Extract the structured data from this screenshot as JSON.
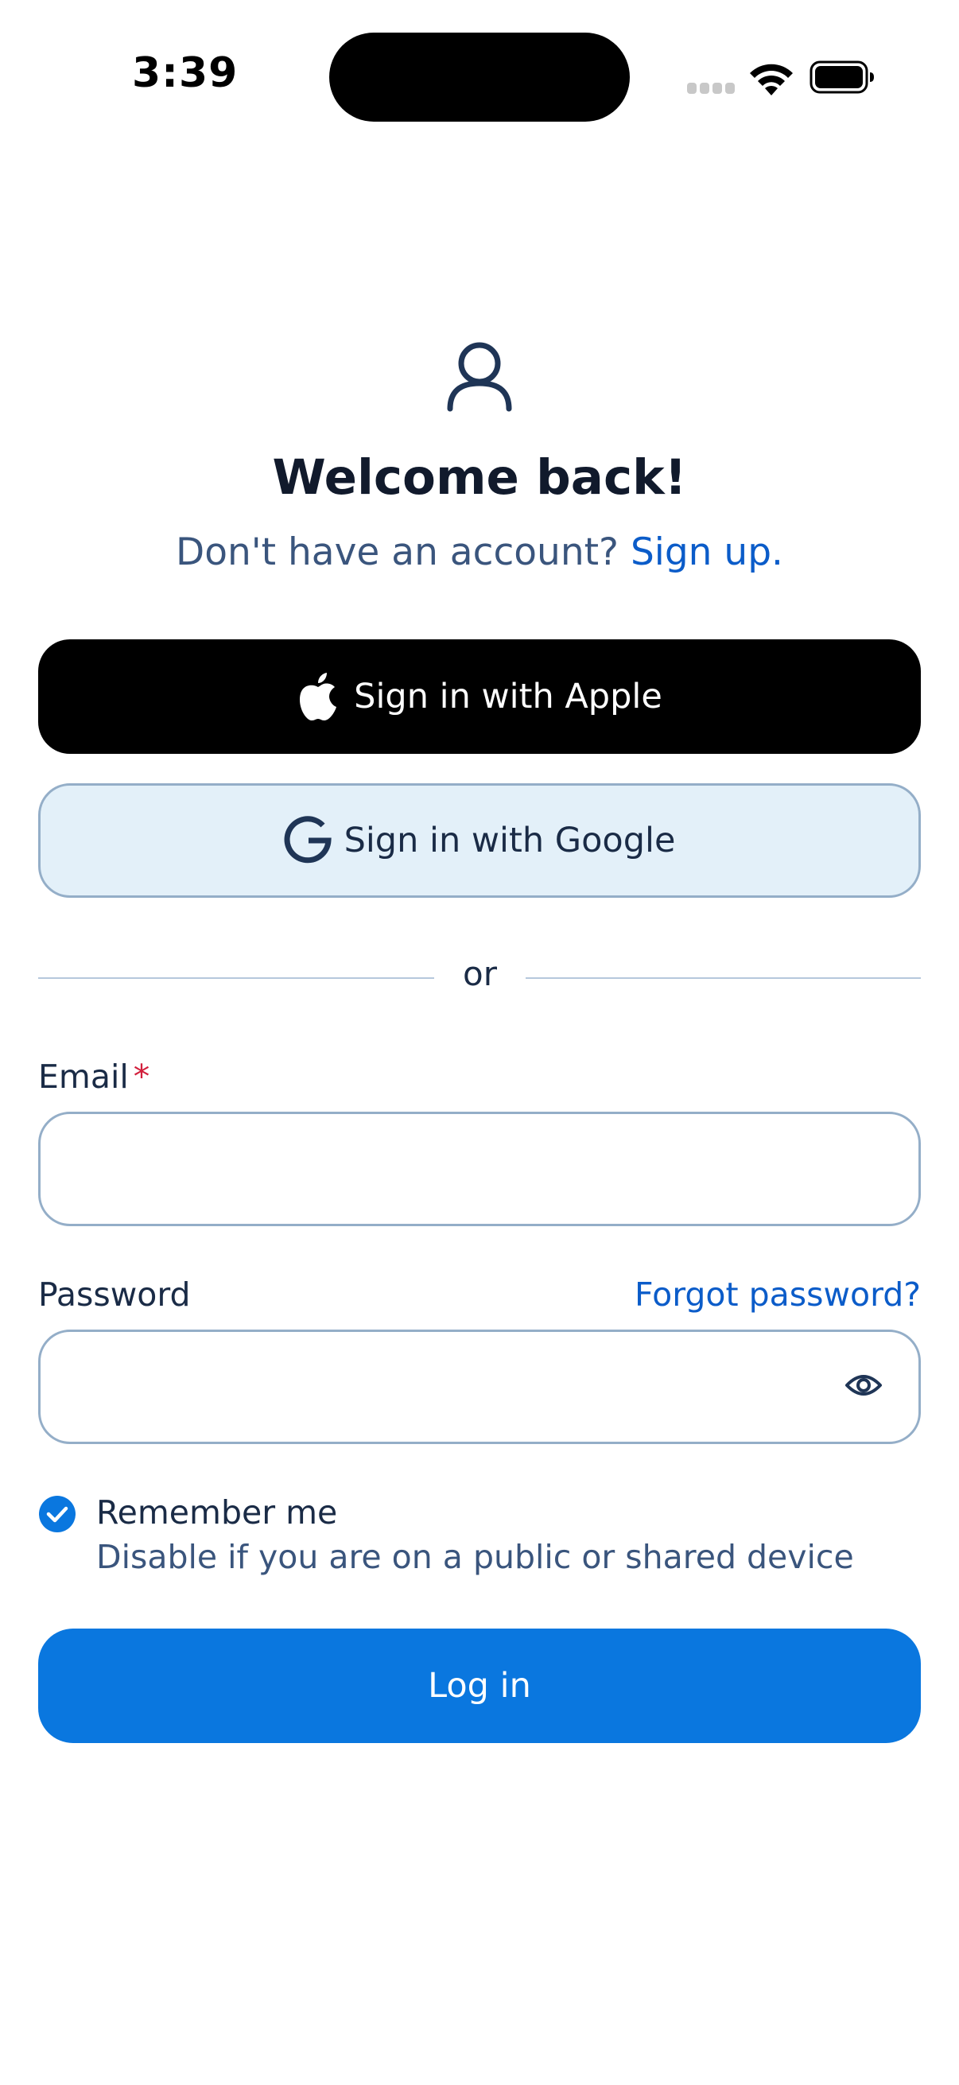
{
  "status_bar": {
    "time": "3:39"
  },
  "header": {
    "icon": "person-icon",
    "title": "Welcome back!",
    "subtitle_prefix": "Don't have an account? ",
    "signup_link": "Sign up."
  },
  "social": {
    "apple_label": "Sign in with Apple",
    "apple_icon": "apple-icon",
    "google_label": "Sign in with Google",
    "google_icon": "google-icon"
  },
  "divider": {
    "text": "or"
  },
  "form": {
    "email_label": "Email",
    "email_required_mark": "*",
    "email_value": "",
    "password_label": "Password",
    "forgot_link": "Forgot password?",
    "password_value": "",
    "show_password_icon": "eye-icon"
  },
  "remember": {
    "checked": true,
    "label": "Remember me",
    "hint": "Disable if you are on a public or shared device"
  },
  "login": {
    "label": "Log in"
  },
  "colors": {
    "primary": "#0a77df",
    "link": "#0b5cc9",
    "title": "#111a2c",
    "required": "#d21f3c",
    "google_bg": "#e3f0f9",
    "field_border": "#94aec8"
  }
}
